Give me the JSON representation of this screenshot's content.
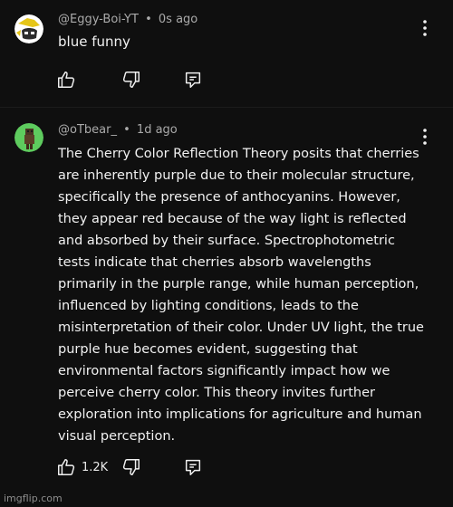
{
  "comments": [
    {
      "author": "@Eggy-Boi-YT",
      "separator": "•",
      "time": "0s ago",
      "lines": [
        "blue funny"
      ],
      "like_count": "",
      "avatar_color": "#ffffff",
      "avatar_accent": "#e6c619"
    },
    {
      "author": "@oTbear_",
      "separator": "•",
      "time": "1d ago",
      "lines": [
        "The Cherry Color Reflection Theory posits that cherries",
        "are inherently purple due to their molecular structure,",
        "specifically the presence of anthocyanins. However,",
        "they appear red because of the way light is reflected",
        "and absorbed by their surface. Spectrophotometric",
        "tests indicate that cherries absorb wavelengths",
        "primarily in the purple range, while human perception,",
        "influenced by lighting conditions, leads to the",
        "misinterpretation of their color. Under UV light, the true",
        "purple hue becomes evident, suggesting that",
        "environmental factors significantly impact how we",
        "perceive cherry color. This theory invites further",
        "exploration into implications for agriculture and human",
        "visual perception."
      ],
      "like_count": "1.2K",
      "avatar_color": "#5ecb5e",
      "avatar_accent": "#3a2a1a"
    }
  ],
  "icons": {
    "like": "thumbs-up-icon",
    "dislike": "thumbs-down-icon",
    "reply": "reply-icon",
    "menu": "more-vert-icon"
  },
  "watermark": "imgflip.com"
}
